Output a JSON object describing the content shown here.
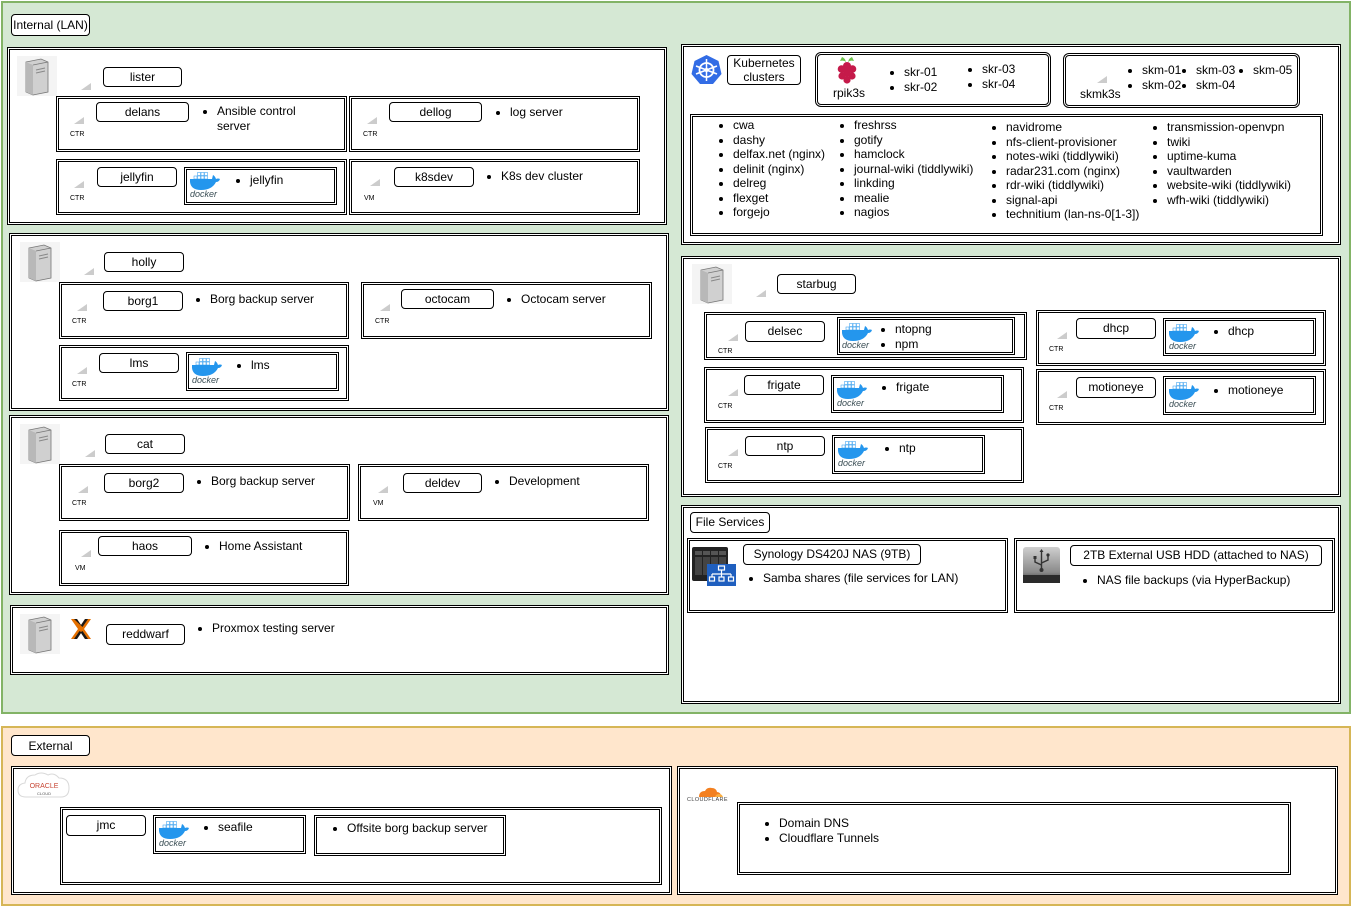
{
  "regions": {
    "internal_title": "Internal (LAN)",
    "external_title": "External"
  },
  "tags": {
    "ctr": "CTR",
    "vm": "VM"
  },
  "docker_text": "docker",
  "hosts": {
    "lister": {
      "name": "lister",
      "delans": {
        "name": "delans",
        "items": [
          "Ansible control server"
        ]
      },
      "dellog": {
        "name": "dellog",
        "items": [
          "log server"
        ]
      },
      "jellyfin": {
        "name": "jellyfin",
        "docker_items": [
          "jellyfin"
        ]
      },
      "k8sdev": {
        "name": "k8sdev",
        "items": [
          "K8s dev cluster"
        ]
      }
    },
    "holly": {
      "name": "holly",
      "borg1": {
        "name": "borg1",
        "items": [
          "Borg backup server"
        ]
      },
      "octocam": {
        "name": "octocam",
        "items": [
          "Octocam server"
        ]
      },
      "lms": {
        "name": "lms",
        "docker_items": [
          "lms"
        ]
      }
    },
    "cat": {
      "name": "cat",
      "borg2": {
        "name": "borg2",
        "items": [
          "Borg backup server"
        ]
      },
      "deldev": {
        "name": "deldev",
        "items": [
          "Development"
        ]
      },
      "haos": {
        "name": "haos",
        "items": [
          "Home Assistant"
        ]
      }
    },
    "reddwarf": {
      "name": "reddwarf",
      "items": [
        "Proxmox testing server"
      ]
    },
    "starbug": {
      "name": "starbug",
      "delsec": {
        "name": "delsec",
        "docker_items": [
          "ntopng",
          "npm"
        ]
      },
      "dhcp": {
        "name": "dhcp",
        "docker_items": [
          "dhcp"
        ]
      },
      "frigate": {
        "name": "frigate",
        "docker_items": [
          "frigate"
        ]
      },
      "motioneye": {
        "name": "motioneye",
        "docker_items": [
          "motioneye"
        ]
      },
      "ntp": {
        "name": "ntp",
        "docker_items": [
          "ntp"
        ]
      }
    }
  },
  "kubernetes": {
    "title": "Kubernetes clusters",
    "rpik3s": {
      "name": "rpik3s",
      "col1": [
        "skr-01",
        "skr-02"
      ],
      "col2": [
        "skr-03",
        "skr-04"
      ]
    },
    "skmk3s": {
      "name": "skmk3s",
      "col1": [
        "skm-01",
        "skm-02"
      ],
      "col2": [
        "skm-03",
        "skm-04"
      ],
      "col3": [
        "skm-05"
      ]
    },
    "apps": {
      "col1": [
        "cwa",
        "dashy",
        "delfax.net (nginx)",
        "delinit (nginx)",
        "delreg",
        "flexget",
        "forgejo"
      ],
      "col2": [
        "freshrss",
        "gotify",
        "hamclock",
        "journal-wiki (tiddlywiki)",
        "linkding",
        "mealie",
        "nagios"
      ],
      "col3": [
        "navidrome",
        "nfs-client-provisioner",
        "notes-wiki (tiddlywiki)",
        "radar231.com (nginx)",
        "rdr-wiki (tiddlywiki)",
        "signal-api",
        "technitium (lan-ns-0[1-3])"
      ],
      "col4": [
        "transmission-openvpn",
        "twiki",
        "uptime-kuma",
        "vaultwarden",
        "website-wiki (tiddlywiki)",
        "wfh-wiki (tiddlywiki)"
      ]
    }
  },
  "file_services": {
    "title": "File Services",
    "nas": {
      "name": "Synology DS420J NAS (9TB)",
      "items": [
        "Samba shares (file services for LAN)"
      ]
    },
    "usb": {
      "name": "2TB External USB HDD (attached to NAS)",
      "items": [
        "NAS file backups (via HyperBackup)"
      ]
    }
  },
  "external": {
    "oracle": {
      "logo_line1": "ORACLE",
      "logo_line2": "CLOUD"
    },
    "jmc": {
      "name": "jmc",
      "docker_items": [
        "seafile"
      ],
      "items": [
        "Offsite borg backup server"
      ]
    },
    "cloudflare": {
      "logo": "CLOUDFLARE",
      "items": [
        "Domain DNS",
        "Cloudflare Tunnels"
      ]
    }
  },
  "colors": {
    "lan_fill": "#d5e8d4",
    "lan_border": "#82b366",
    "ext_fill": "#ffe6cc",
    "ext_border": "#d6b656",
    "docker_blue": "#2496ed",
    "k8s_blue": "#326ce5",
    "raspberry_red": "#c51a4a",
    "cloudflare_orange": "#f38020",
    "proxmox_orange": "#e57000",
    "oracle_red": "#c74634"
  },
  "icons": [
    "server-icon",
    "docker-icon",
    "kubernetes-icon",
    "raspberry-pi-icon",
    "proxmox-icon",
    "nas-icon",
    "usb-drive-icon",
    "oracle-cloud-logo",
    "cloudflare-logo"
  ]
}
